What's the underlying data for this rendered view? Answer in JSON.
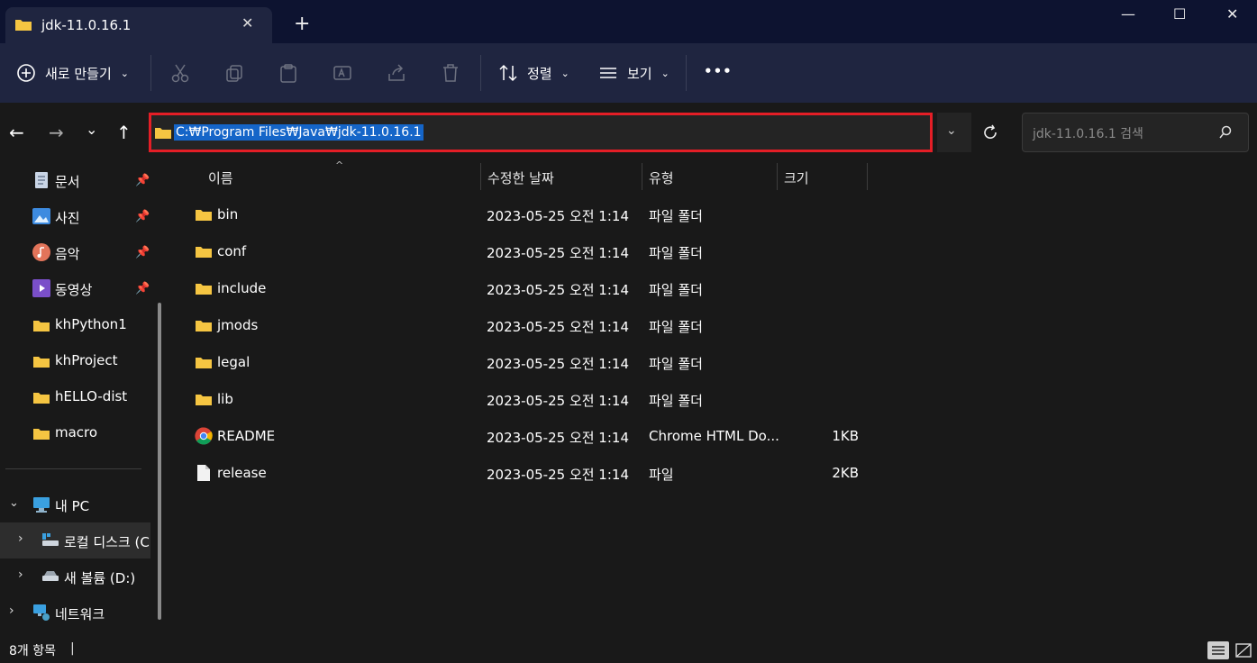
{
  "window": {
    "tab_title": "jdk-11.0.16.1",
    "tab_close": "✕",
    "new_tab": "+",
    "minimize": "—",
    "maximize": "☐",
    "close": "✕"
  },
  "toolbar": {
    "new_label": "새로 만들기",
    "sort_label": "정렬",
    "view_label": "보기",
    "more": "•••"
  },
  "address": {
    "path": "C:₩Program Files₩Java₩jdk-11.0.16.1",
    "search_placeholder": "jdk-11.0.16.1 검색"
  },
  "sidebar": {
    "quick_access": [
      {
        "label": "문서",
        "pinned": true
      },
      {
        "label": "사진",
        "pinned": true
      },
      {
        "label": "음악",
        "pinned": true
      },
      {
        "label": "동영상",
        "pinned": true
      },
      {
        "label": "khPython1",
        "pinned": false
      },
      {
        "label": "khProject",
        "pinned": false
      },
      {
        "label": "hELLO-dist",
        "pinned": false
      },
      {
        "label": "macro",
        "pinned": false
      }
    ],
    "this_pc": "내 PC",
    "local_disk": "로컬 디스크 (C",
    "new_volume": "새 볼륨 (D:)",
    "network": "네트워크"
  },
  "columns": {
    "name": "이름",
    "modified": "수정한 날짜",
    "type": "유형",
    "size": "크기"
  },
  "files": [
    {
      "name": "bin",
      "modified": "2023-05-25 오전 1:14",
      "type": "파일 폴더",
      "size": "",
      "icon": "folder-icon"
    },
    {
      "name": "conf",
      "modified": "2023-05-25 오전 1:14",
      "type": "파일 폴더",
      "size": "",
      "icon": "folder-icon"
    },
    {
      "name": "include",
      "modified": "2023-05-25 오전 1:14",
      "type": "파일 폴더",
      "size": "",
      "icon": "folder-icon"
    },
    {
      "name": "jmods",
      "modified": "2023-05-25 오전 1:14",
      "type": "파일 폴더",
      "size": "",
      "icon": "folder-icon"
    },
    {
      "name": "legal",
      "modified": "2023-05-25 오전 1:14",
      "type": "파일 폴더",
      "size": "",
      "icon": "folder-icon"
    },
    {
      "name": "lib",
      "modified": "2023-05-25 오전 1:14",
      "type": "파일 폴더",
      "size": "",
      "icon": "folder-icon"
    },
    {
      "name": "README",
      "modified": "2023-05-25 오전 1:14",
      "type": "Chrome HTML Do...",
      "size": "1KB",
      "icon": "chrome-icon"
    },
    {
      "name": "release",
      "modified": "2023-05-25 오전 1:14",
      "type": "파일",
      "size": "2KB",
      "icon": "file-icon"
    }
  ],
  "status": {
    "count": "8개 항목",
    "divider": "|"
  },
  "colors": {
    "accent_selection": "#1565c8",
    "highlight_border": "#e41e26",
    "folder": "#f5c542"
  }
}
